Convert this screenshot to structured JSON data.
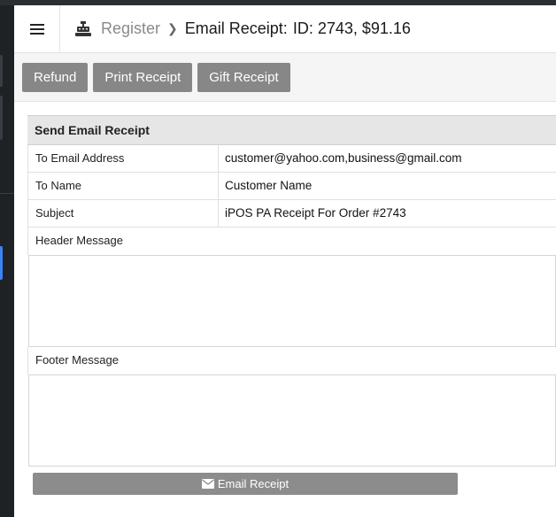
{
  "header": {
    "breadcrumb_register": "Register",
    "page_title": "Email Receipt:",
    "order_id": "ID: 2743, $91.16"
  },
  "toolbar": {
    "refund_label": "Refund",
    "print_label": "Print Receipt",
    "gift_label": "Gift Receipt"
  },
  "form": {
    "section_title": "Send Email Receipt",
    "to_email_label": "To Email Address",
    "to_email_value": "customer@yahoo.com,business@gmail.com",
    "to_name_label": "To Name",
    "to_name_value": "Customer Name",
    "subject_label": "Subject",
    "subject_value": "iPOS PA Receipt For Order #2743",
    "header_message_label": "Header Message",
    "header_message_value": "",
    "footer_message_label": "Footer Message",
    "footer_message_value": "",
    "send_label": "Email Receipt"
  },
  "icons": {
    "menu": "hamburger-icon",
    "register": "cash-register-icon",
    "breadcrumb_separator": "chevron-right-icon",
    "send": "envelope-icon"
  },
  "colors": {
    "button_gray": "#878787",
    "nav_active": "#3b82f6"
  }
}
